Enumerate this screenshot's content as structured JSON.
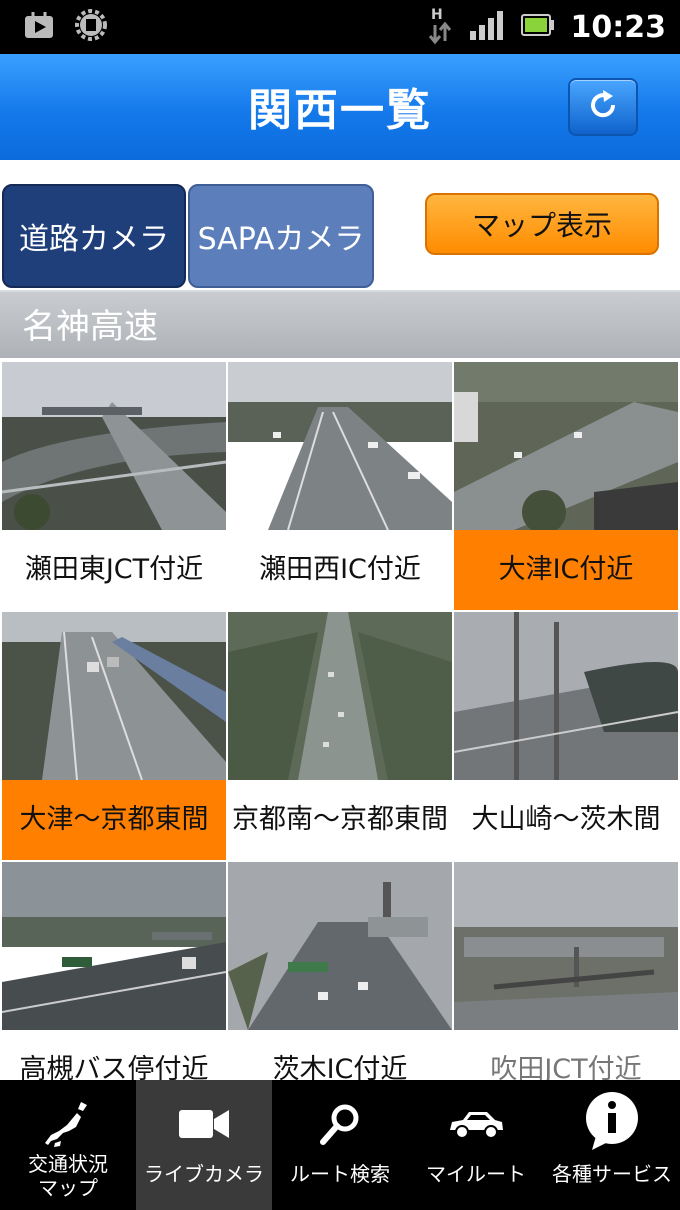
{
  "status_bar": {
    "time": "10:23",
    "left_icons": [
      "play-store-icon",
      "settings-gear-icon"
    ],
    "network_label": "H",
    "right_icons": [
      "data-arrows-icon",
      "signal-icon",
      "battery-icon"
    ]
  },
  "header": {
    "title": "関西一覧",
    "refresh_icon": "refresh-icon"
  },
  "tabs": {
    "road_camera": "道路カメラ",
    "sapa_camera": "SAPAカメラ",
    "map_button": "マップ表示"
  },
  "section": {
    "title": "名神高速"
  },
  "cameras": [
    {
      "label": "瀬田東JCT付近",
      "highlight": false
    },
    {
      "label": "瀬田西IC付近",
      "highlight": false
    },
    {
      "label": "大津IC付近",
      "highlight": true
    },
    {
      "label": "大津～京都東間",
      "highlight": true
    },
    {
      "label": "京都南～京都東間",
      "highlight": false
    },
    {
      "label": "大山崎～茨木間",
      "highlight": false
    },
    {
      "label": "高槻バス停付近",
      "highlight": false
    },
    {
      "label": "茨木IC付近",
      "highlight": false
    },
    {
      "label": "吹田JCT付近",
      "highlight": false
    }
  ],
  "colors": {
    "header_blue": "#1479ea",
    "tab_active": "#1f3f7b",
    "tab_inactive": "#5c7fbc",
    "highlight_orange": "#ff7f00"
  },
  "bottom_nav": [
    {
      "label": "交通状況\nマップ",
      "icon": "japan-map-icon",
      "active": false
    },
    {
      "label": "ライブカメラ",
      "icon": "video-camera-icon",
      "active": true
    },
    {
      "label": "ルート検索",
      "icon": "magnifier-icon",
      "active": false
    },
    {
      "label": "マイルート",
      "icon": "car-icon",
      "active": false
    },
    {
      "label": "各種サービス",
      "icon": "info-icon",
      "active": false
    }
  ]
}
